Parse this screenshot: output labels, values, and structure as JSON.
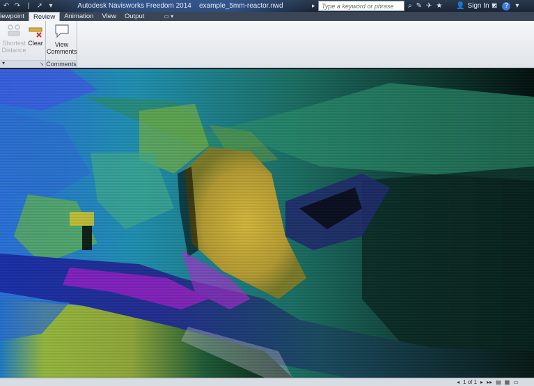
{
  "titlebar": {
    "app_title": "Autodesk Navisworks Freedom 2014",
    "file_name": "example_5mm-reactor.nwd",
    "search_placeholder": "Type a keyword or phrase",
    "sign_in": "Sign In",
    "help": "?"
  },
  "tabs": [
    {
      "label": "Viewpoint"
    },
    {
      "label": "Review"
    },
    {
      "label": "Animation"
    },
    {
      "label": "View"
    },
    {
      "label": "Output"
    }
  ],
  "ribbon": {
    "measure_panel": {
      "shortest_label_1": "Shortest",
      "shortest_label_2": "Distance",
      "clear_label": "Clear"
    },
    "comments_panel": {
      "view_label_1": "View",
      "view_label_2": "Comments",
      "title": "Comments"
    }
  },
  "statusbar": {
    "page": "1 of 1"
  }
}
